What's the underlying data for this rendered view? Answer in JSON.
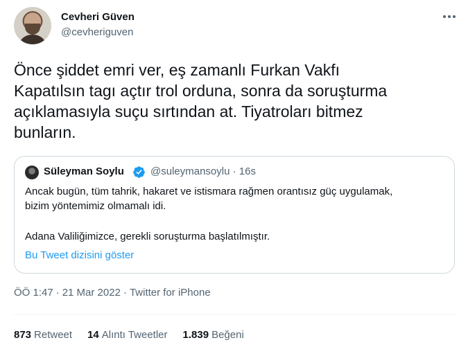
{
  "author": {
    "name": "Cevheri Güven",
    "handle": "@cevheriguven"
  },
  "tweet": {
    "lines": [
      "Önce şiddet emri ver, eş zamanlı Furkan Vakfı",
      "Kapatılsın tagı açtır trol orduna, sonra da soruşturma",
      "açıklamasıyla suçu sırtından at. Tiyatroları bitmez",
      "bunların."
    ]
  },
  "quoted": {
    "name": "Süleyman Soylu",
    "handle_time": "@suleymansoylu · 16s",
    "lines": [
      "Ancak bugün, tüm tahrik, hakaret ve istismara rağmen orantısız güç uygulamak,",
      "bizim yöntemimiz olmamalı idi.",
      "",
      "Adana Valiliğimizce, gerekli soruşturma başlatılmıştır."
    ],
    "show_thread": "Bu Tweet dizisini göster"
  },
  "meta": {
    "time": "ÖÖ 1:47",
    "date": "21 Mar 2022",
    "separator": "·",
    "source": "Twitter for iPhone"
  },
  "stats": {
    "retweets_count": "873",
    "retweets_label": "Retweet",
    "quotes_count": "14",
    "quotes_label": "Alıntı Tweetler",
    "likes_count": "1.839",
    "likes_label": "Beğeni"
  },
  "colors": {
    "text": "#0f1419",
    "secondary": "#536471",
    "link": "#1d9bf0",
    "border": "#cfd9de"
  },
  "icons": [
    "more-icon",
    "verified-badge-icon"
  ]
}
